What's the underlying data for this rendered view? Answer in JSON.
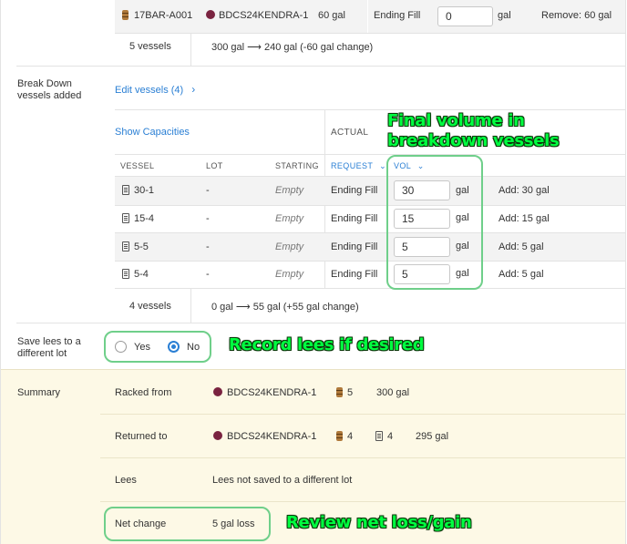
{
  "top_row": {
    "source_vessel": "17BAR-A001",
    "source_lot": "BDCS24KENDRA-1",
    "source_volume": "60 gal",
    "request": "Ending Fill",
    "input_value": "0",
    "unit": "gal",
    "result": "Remove: 60 gal"
  },
  "source_summary": {
    "count": "5 vessels",
    "change": "300 gal ⟶ 240 gal (-60 gal change)"
  },
  "breakdown": {
    "label_line1": "Break Down",
    "label_line2": "vessels added",
    "edit_link": "Edit vessels (4)",
    "show_capacities": "Show Capacities",
    "actual_header": "ACTUAL",
    "columns": {
      "vessel": "VESSEL",
      "lot": "LOT",
      "starting": "STARTING",
      "request": "REQUEST",
      "vol": "VOL"
    },
    "rows": [
      {
        "vessel": "30-1",
        "lot": "-",
        "starting": "Empty",
        "request": "Ending Fill",
        "value": "30",
        "unit": "gal",
        "result": "Add: 30 gal"
      },
      {
        "vessel": "15-4",
        "lot": "-",
        "starting": "Empty",
        "request": "Ending Fill",
        "value": "15",
        "unit": "gal",
        "result": "Add: 15 gal"
      },
      {
        "vessel": "5-5",
        "lot": "-",
        "starting": "Empty",
        "request": "Ending Fill",
        "value": "5",
        "unit": "gal",
        "result": "Add: 5 gal"
      },
      {
        "vessel": "5-4",
        "lot": "-",
        "starting": "Empty",
        "request": "Ending Fill",
        "value": "5",
        "unit": "gal",
        "result": "Add: 5 gal"
      }
    ],
    "count": "4 vessels",
    "change": "0 gal ⟶ 55 gal (+55 gal change)"
  },
  "lees": {
    "label_line1": "Save lees to a",
    "label_line2": "different lot",
    "yes": "Yes",
    "no": "No"
  },
  "summary": {
    "label": "Summary",
    "racked_from_label": "Racked from",
    "racked_from_lot": "BDCS24KENDRA-1",
    "racked_from_barrels": "5",
    "racked_from_volume": "300 gal",
    "returned_to_label": "Returned to",
    "returned_to_lot": "BDCS24KENDRA-1",
    "returned_to_barrels": "4",
    "returned_to_tanks": "4",
    "returned_to_volume": "295 gal",
    "lees_label": "Lees",
    "lees_value": "Lees not saved to a different lot",
    "net_change_label": "Net change",
    "net_change_value": "5 gal loss"
  },
  "annotations": {
    "final_volume_line1": "Final volume in",
    "final_volume_line2": "breakdown vessels",
    "record_lees": "Record lees if desired",
    "review_net": "Review net loss/gain"
  },
  "colors": {
    "accent": "#2a7fd4",
    "lot_dot": "#7a2340",
    "summary_bg": "#fdf9e6",
    "annotation_text": "#00ff40",
    "annotation_box": "#6fcf8a"
  }
}
